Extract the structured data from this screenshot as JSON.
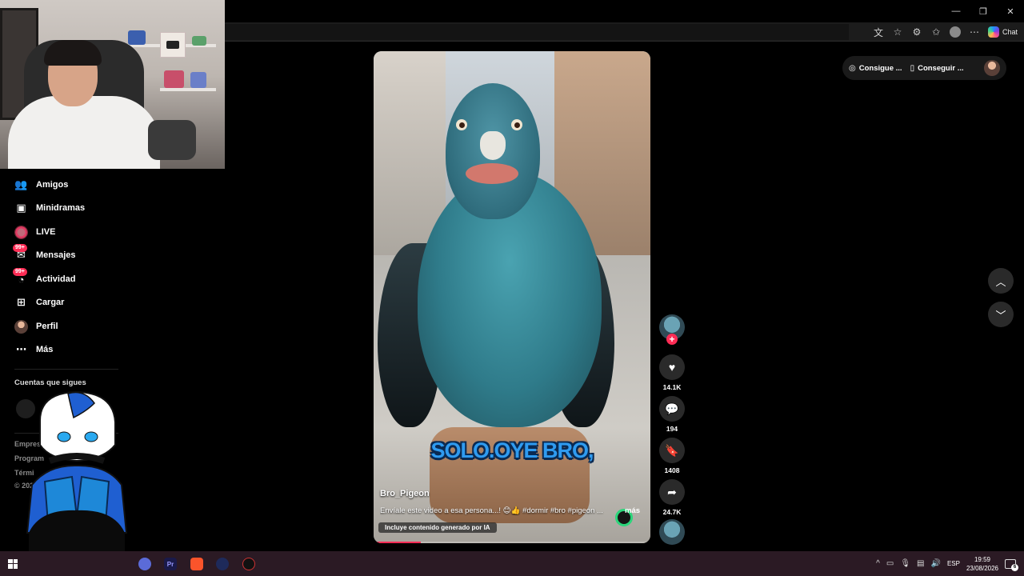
{
  "window": {
    "minimize": "—",
    "restore": "❐",
    "close": "✕"
  },
  "toolbar": {
    "chat_label": "Chat"
  },
  "sidebar": {
    "items": [
      {
        "label": "Amigos",
        "icon": "friends-icon"
      },
      {
        "label": "Minidramas",
        "icon": "minidramas-icon"
      },
      {
        "label": "LIVE",
        "icon": "live-icon"
      },
      {
        "label": "Mensajes",
        "icon": "messages-icon",
        "badge": "99+"
      },
      {
        "label": "Actividad",
        "icon": "activity-icon",
        "badge": "99+"
      },
      {
        "label": "Cargar",
        "icon": "upload-icon"
      },
      {
        "label": "Perfil",
        "icon": "profile-icon"
      },
      {
        "label": "Más",
        "icon": "more-icon"
      }
    ],
    "following_title": "Cuentas que sigues",
    "footer": [
      "Empresa",
      "Program",
      "Térmi",
      "© 202"
    ]
  },
  "video": {
    "caption_overlay": "SOLO.OYE BRO,",
    "username": "Bro_Pigeon",
    "description": "Envíale este video a esa persona...! 😊👍 #dormir #bro #pigeon ...",
    "more_label": "más",
    "ai_label": "Incluye contenido generado por IA",
    "progress": 0.17
  },
  "actions": {
    "follow_plus": "+",
    "likes": "14.1K",
    "comments": "194",
    "saves": "1408",
    "shares": "24.7K"
  },
  "top_right": {
    "coins_label": "Consigue ...",
    "app_label": "Conseguir ..."
  },
  "taskbar": {
    "premiere_label": "Pr",
    "language": "ESP",
    "time": "19:59",
    "date": "23/08/2026",
    "notifications": "6"
  },
  "colors": {
    "accent": "#fe2c55",
    "caption_blue": "#2f9bf0",
    "taskbar": "#2b1a24"
  }
}
